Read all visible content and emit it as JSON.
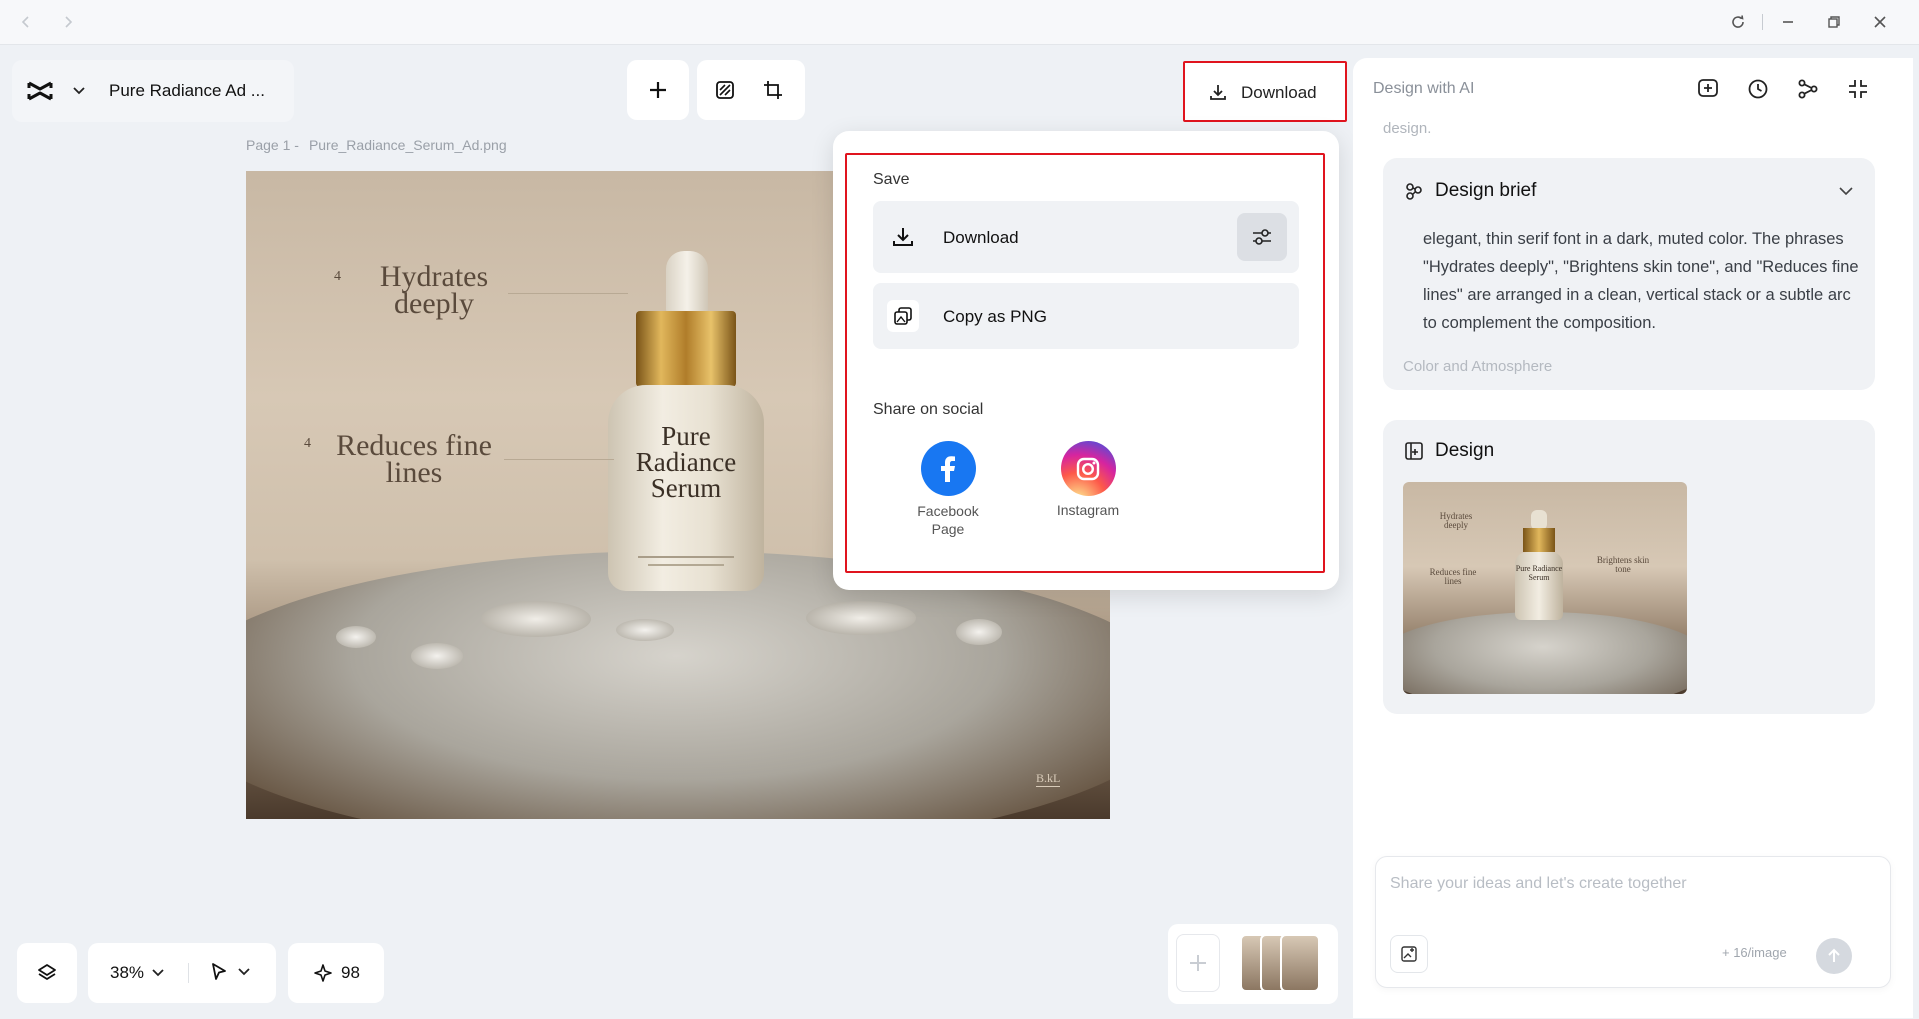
{
  "window": {
    "back": "back",
    "forward": "forward",
    "reload": "reload",
    "minimize": "minimize",
    "restore": "restore",
    "close": "close"
  },
  "project": {
    "title": "Pure Radiance Ad ..."
  },
  "toolbar": {
    "add": "plus-icon",
    "remove_bg": "erase-icon",
    "resize": "resize-icon"
  },
  "download_button": {
    "label": "Download"
  },
  "canvas": {
    "page_label": "Page 1 -",
    "file_name": "Pure_Radiance_Serum_Ad.png",
    "ad": {
      "benefit_1_num": "4",
      "benefit_1": "Hydrates\ndeeply",
      "benefit_2_num": "4",
      "benefit_2": "Reduces fine\nlines",
      "product_name": "Pure\nRadiance\nSerum",
      "brand_mark": "B.kL"
    }
  },
  "download_menu": {
    "save_heading": "Save",
    "download_label": "Download",
    "copy_label": "Copy as PNG",
    "share_heading": "Share on social",
    "social": [
      {
        "name": "Facebook\nPage",
        "color": "#1877f2"
      },
      {
        "name": "Instagram",
        "color": "#d62976"
      }
    ]
  },
  "ai_panel": {
    "title": "Design with AI",
    "faded_top": "design.",
    "brief": {
      "heading": "Design brief",
      "body": "elegant, thin serif font in a dark, muted color. The phrases \"Hydrates deeply\", \"Brightens skin tone\", and \"Reduces fine lines\" are arranged in a clean, vertical stack or a subtle arc to complement the composition.",
      "faded_next": "Color and Atmosphere"
    },
    "design": {
      "heading": "Design",
      "thumb_text_1": "Hydrates deeply",
      "thumb_text_2": "Reduces fine lines",
      "thumb_text_3": "Brightens skin tone",
      "thumb_product": "Pure Radiance Serum"
    },
    "input": {
      "placeholder": "Share your ideas and let's create together",
      "cost": "+ 16/image"
    }
  },
  "bottom_bar": {
    "zoom": "38%",
    "credits": "98"
  },
  "colors": {
    "accent_red": "#e0141e",
    "facebook": "#1877f2",
    "panel_bg": "#eef1f5"
  }
}
